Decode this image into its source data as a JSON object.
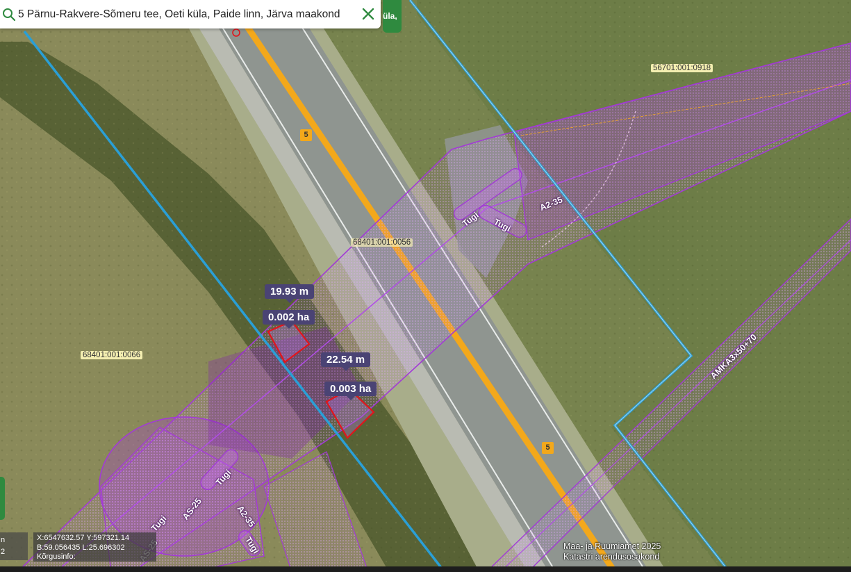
{
  "search": {
    "value": "5 Pärnu-Rakvere-Sõmeru tee, Oeti küla, Paide linn, Järva maakond",
    "chip_text": "üla,"
  },
  "map": {
    "parcels": [
      {
        "id": "p1",
        "label": "56701:001:0918"
      },
      {
        "id": "p2",
        "label": "68401:001:0056"
      },
      {
        "id": "p3",
        "label": "68401:001:0066"
      }
    ],
    "road_number": "5",
    "measurements": [
      {
        "id": "m1",
        "label": "19.93 m"
      },
      {
        "id": "m2",
        "label": "0.002 ha"
      },
      {
        "id": "m3",
        "label": "22.54 m"
      },
      {
        "id": "m4",
        "label": "0.003 ha"
      }
    ],
    "utility_labels": {
      "tugi": "Tugi",
      "a2_35": "A2-35",
      "as_25": "AS-25",
      "amka": "AMKA3x50+70"
    }
  },
  "coords": {
    "xy": "X:6547632.57 Y:597321.14",
    "bl": "B:59.056435 L:25.696302",
    "height": "Kõrgusinfo:"
  },
  "left_panel": {
    "line1": "n",
    "line2": "2"
  },
  "attribution": {
    "line1": "Maa- ja Ruumiamet 2025",
    "line2": "Katastri arendusosakond"
  },
  "colors": {
    "parcel_border": "#2a9fd6",
    "utility_zone": "#b04ce6",
    "measure_outline": "#e3141b",
    "road_center": "#f3a81b"
  }
}
